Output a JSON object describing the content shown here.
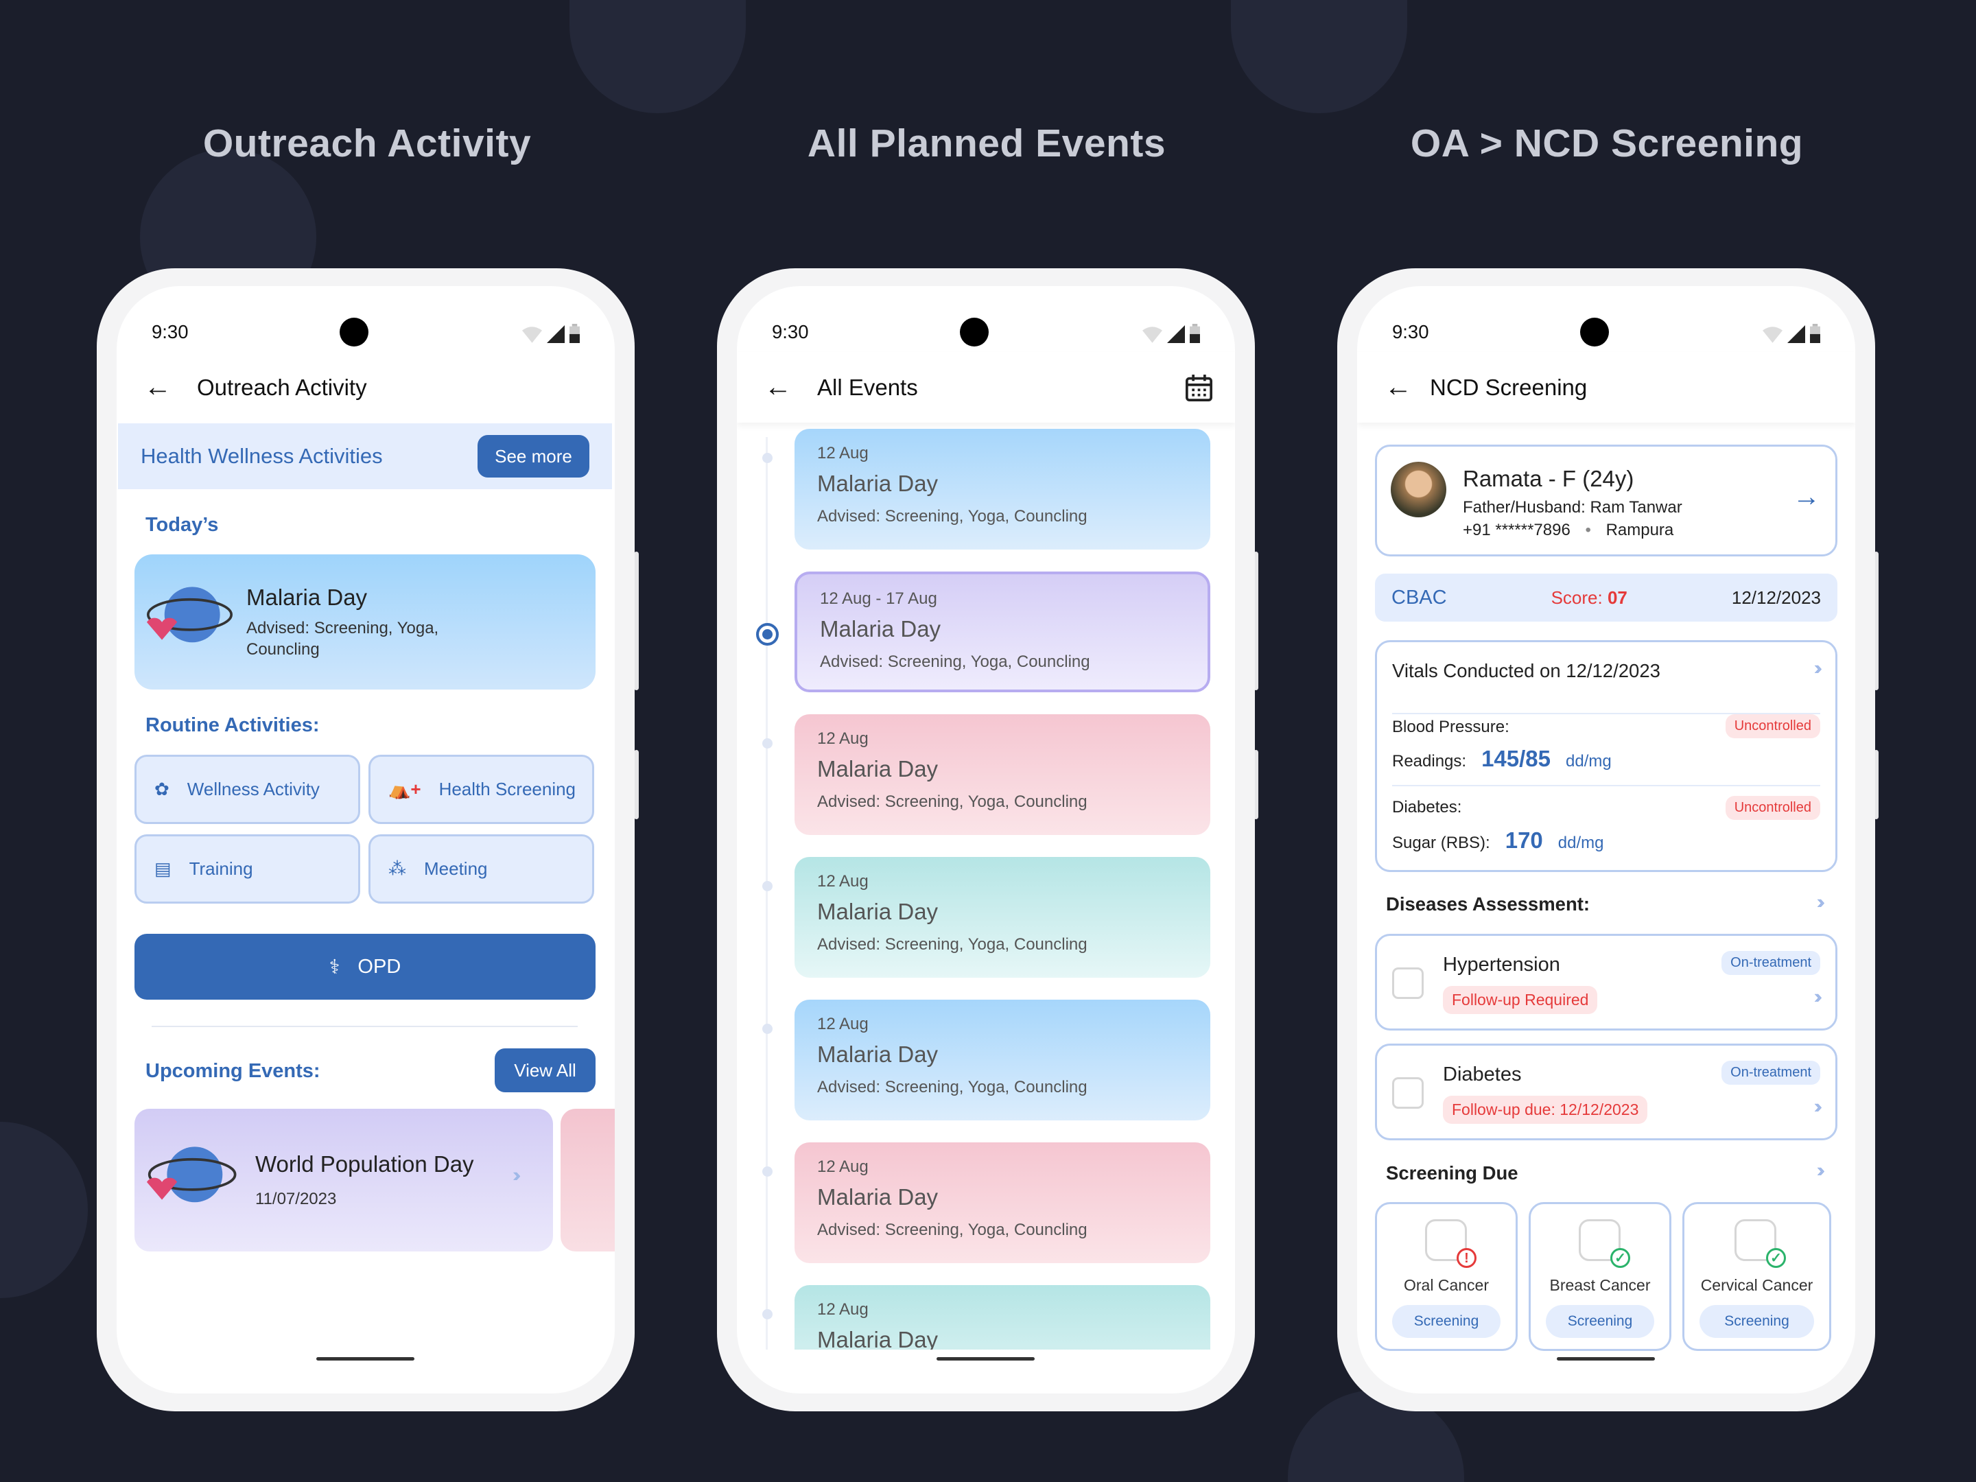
{
  "titles": [
    "Outreach Activity",
    "All Planned Events",
    "OA > NCD Screening"
  ],
  "status_time": "9:30",
  "colors": {
    "primary": "#3469b5",
    "danger": "#e53a3a",
    "success": "#2bb36b",
    "background": "#1b1e2b"
  },
  "outreach": {
    "header": "Outreach Activity",
    "banner": {
      "title": "Health Wellness Activities",
      "button": "See more"
    },
    "todays_label": "Today’s",
    "today_card": {
      "title": "Malaria Day",
      "advised": "Advised: Screening, Yoga, Councling"
    },
    "routine_label": "Routine Activities:",
    "routine": [
      {
        "label": "Wellness Activity",
        "icon": "lotus-icon"
      },
      {
        "label": "Health Screening",
        "icon": "tent-medical-icon"
      },
      {
        "label": "Training",
        "icon": "training-board-icon"
      },
      {
        "label": "Meeting",
        "icon": "people-icon"
      }
    ],
    "opd_label": "OPD",
    "upcoming_label": "Upcoming Events:",
    "view_all": "View All",
    "upcoming": [
      {
        "title": "World Population Day",
        "date": "11/07/2023"
      }
    ]
  },
  "events": {
    "header": "All Events",
    "items": [
      {
        "date": "12 Aug",
        "title": "Malaria Day",
        "advised": "Advised: Screening, Yoga, Councling",
        "color": "blue"
      },
      {
        "date": "12 Aug - 17 Aug",
        "title": "Malaria Day",
        "advised": "Advised: Screening, Yoga, Councling",
        "color": "purple",
        "selected": true
      },
      {
        "date": "12 Aug",
        "title": "Malaria Day",
        "advised": "Advised: Screening, Yoga, Councling",
        "color": "pink"
      },
      {
        "date": "12 Aug",
        "title": "Malaria Day",
        "advised": "Advised: Screening, Yoga, Councling",
        "color": "teal"
      },
      {
        "date": "12 Aug",
        "title": "Malaria Day",
        "advised": "Advised: Screening, Yoga, Councling",
        "color": "blue"
      },
      {
        "date": "12 Aug",
        "title": "Malaria Day",
        "advised": "Advised: Screening, Yoga, Councling",
        "color": "pink"
      },
      {
        "date": "12 Aug",
        "title": "Malaria Day",
        "advised": "",
        "color": "teal"
      }
    ]
  },
  "ncd": {
    "header": "NCD Screening",
    "patient": {
      "name": "Ramata - F (24y)",
      "guardian_label": "Father/Husband:",
      "guardian": "Ram Tanwar",
      "phone": "+91 ******7896",
      "village": "Rampura"
    },
    "cbac": {
      "label": "CBAC",
      "score_label": "Score:",
      "score": "07",
      "date": "12/12/2023"
    },
    "vitals": {
      "title": "Vitals Conducted on 12/12/2023",
      "bp_label": "Blood Pressure:",
      "bp_status": "Uncontrolled",
      "readings_label": "Readings:",
      "bp_value": "145/85",
      "bp_unit": "dd/mg",
      "diab_label": "Diabetes:",
      "diab_status": "Uncontrolled",
      "sugar_label": "Sugar (RBS):",
      "sugar_value": "170",
      "sugar_unit": "dd/mg"
    },
    "diseases_label": "Diseases Assessment:",
    "diseases": [
      {
        "name": "Hypertension",
        "status": "On-treatment",
        "followup": "Follow-up Required"
      },
      {
        "name": "Diabetes",
        "status": "On-treatment",
        "followup": "Follow-up due: 12/12/2023"
      }
    ],
    "screening_label": "Screening Due",
    "screenings": [
      {
        "name": "Oral Cancer",
        "button": "Screening",
        "state": "alert"
      },
      {
        "name": "Breast Cancer",
        "button": "Screening",
        "state": "done"
      },
      {
        "name": "Cervical Cancer",
        "button": "Screening",
        "state": "done"
      }
    ]
  }
}
